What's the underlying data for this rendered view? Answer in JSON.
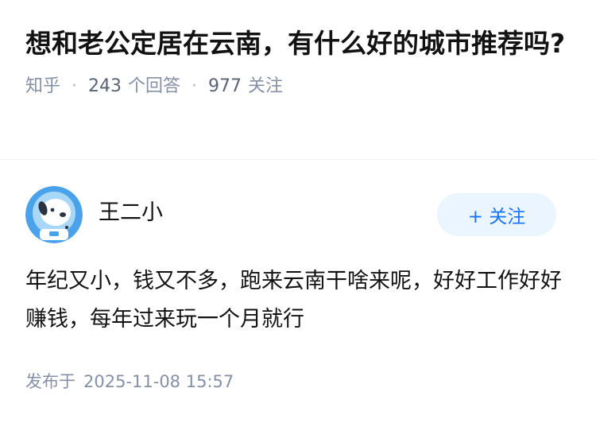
{
  "question": {
    "title": "想和老公定居在云南，有什么好的城市推荐吗?",
    "source": "知乎",
    "answer_count": "243",
    "answer_label": "个回答",
    "follow_count": "977",
    "follow_label": "关注"
  },
  "answer": {
    "author_name": "王二小",
    "follow_button": "+ 关注",
    "content": "年纪又小，钱又不多，跑来云南干啥来呢，好好工作好好赚钱，每年过来玩一个月就行",
    "published_label": "发布于",
    "published_time": "2025-11-08 15:57"
  },
  "colors": {
    "accent": "#1772f6",
    "follow_bg": "#ebf5ff",
    "meta_text": "#8590a6",
    "avatar_bg": "#4aa3ea"
  }
}
